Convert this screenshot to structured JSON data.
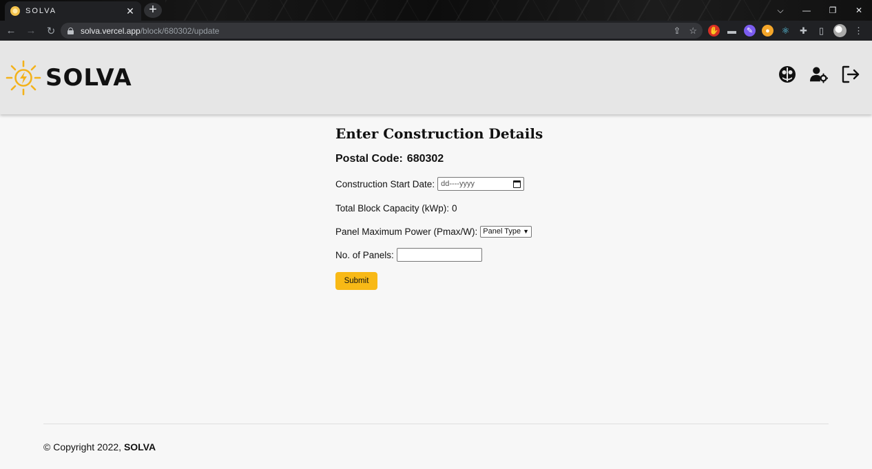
{
  "browser": {
    "tab_title": "SOLVA",
    "tab_close": "✕",
    "new_tab": "+",
    "url_host": "solva.vercel.app",
    "url_path": "/block/680302/update",
    "window_controls": [
      "⌵",
      "—",
      "❐",
      "✕"
    ],
    "nav": {
      "back": "←",
      "forward": "→",
      "reload": "↻"
    }
  },
  "header": {
    "logo_text": "SOLVA",
    "brand_color": "#f3b21b"
  },
  "form": {
    "title": "Enter Construction Details",
    "postal_label": "Postal Code:",
    "postal_value": "680302",
    "start_date_label": "Construction Start Date:",
    "start_date_placeholder": "dd----yyyy",
    "capacity_label": "Total Block Capacity (kWp):",
    "capacity_value": "0",
    "pmax_label": "Panel Maximum Power (Pmax/W):",
    "pmax_selected": "Panel Type",
    "panels_label": "No. of Panels:",
    "panels_value": "",
    "submit_label": "Submit",
    "submit_color": "#f8b916"
  },
  "footer": {
    "copyright": "© Copyright 2022,",
    "brand": "SOLVA"
  }
}
